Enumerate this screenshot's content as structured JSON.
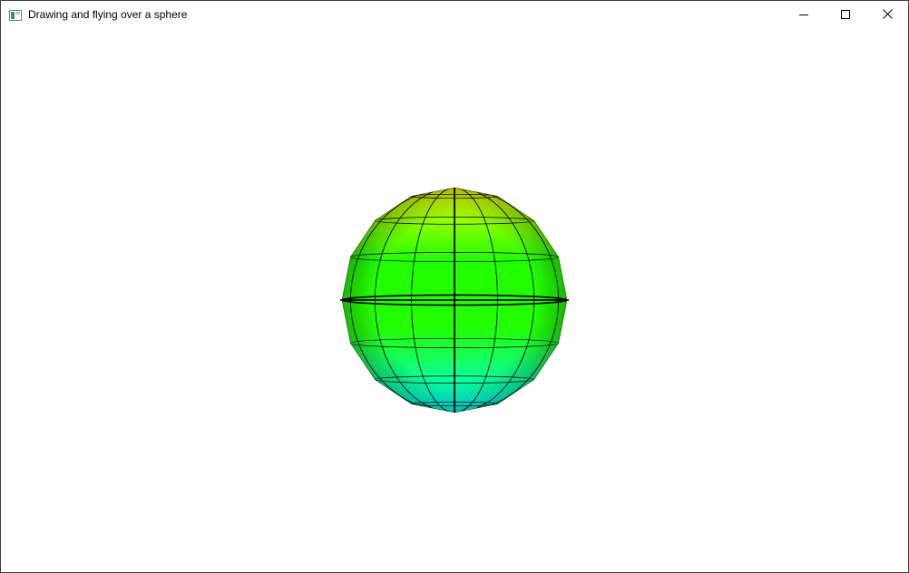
{
  "window": {
    "title": "Drawing and flying over a sphere",
    "icon": "app-window-icon",
    "controls": {
      "minimize_icon": "minimize-icon",
      "maximize_icon": "maximize-icon",
      "close_icon": "close-icon"
    }
  },
  "scene": {
    "object": "sphere",
    "colors": {
      "top": "#f2ff00",
      "middle": "#22ff00",
      "bottom": "#00ffff",
      "edge_shade": "#5a9a00",
      "grid_line": "#000000"
    },
    "latitude_bands": 8,
    "longitude_segments": 16
  }
}
